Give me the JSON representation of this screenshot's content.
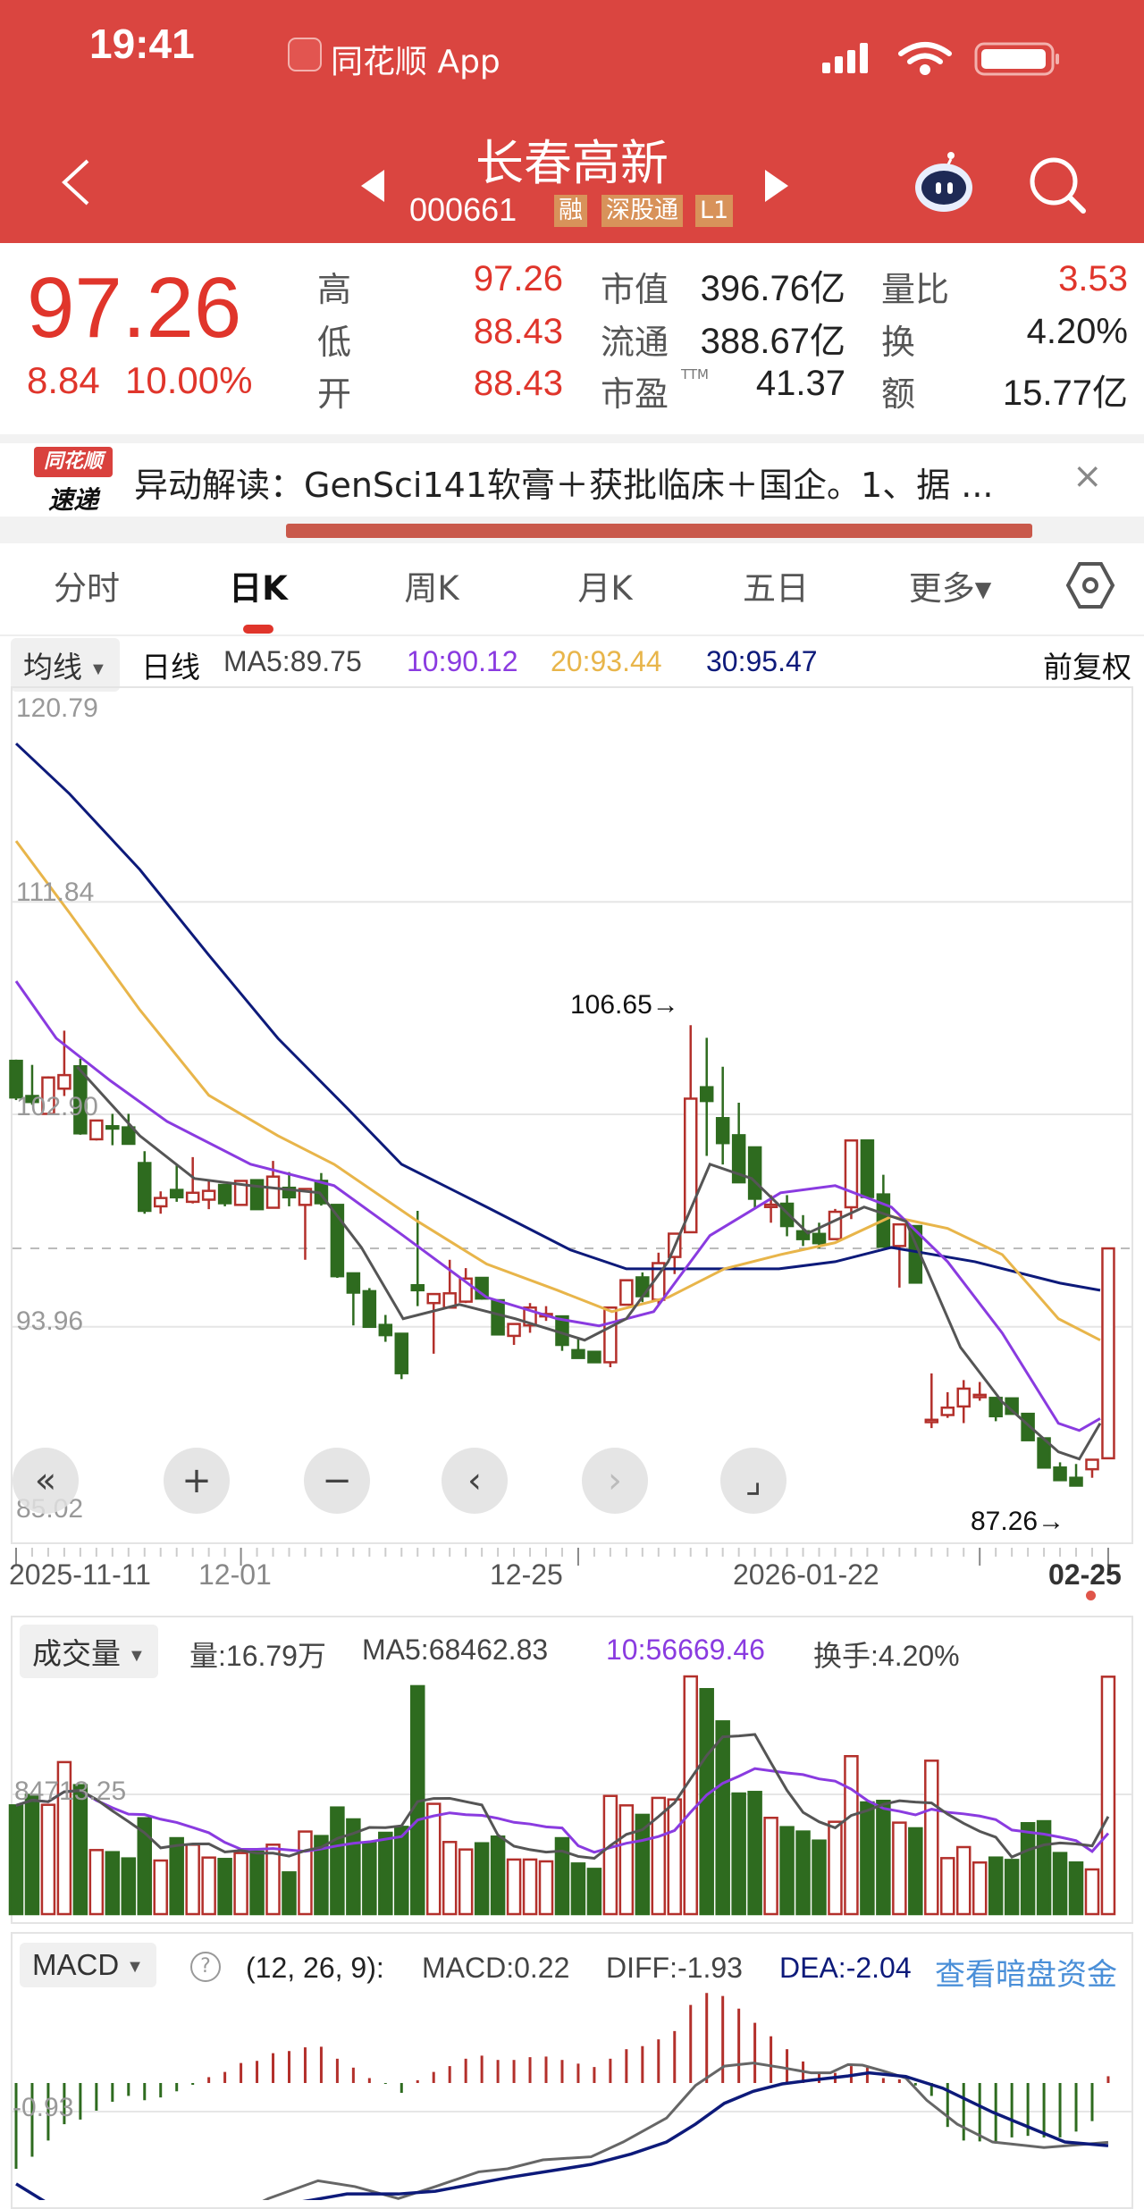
{
  "status_bar": {
    "time": "19:41",
    "app_name": "同花顺 App"
  },
  "stock": {
    "name": "长春高新",
    "code": "000661",
    "badges": [
      "融",
      "深股通",
      "L1"
    ]
  },
  "quote": {
    "price": "97.26",
    "change": "8.84",
    "change_pct": "10.00%",
    "rows": [
      {
        "l1": "高",
        "v1": "97.26",
        "l2": "市值",
        "v2": "396.76亿",
        "l3": "量比",
        "v3": "3.53"
      },
      {
        "l1": "低",
        "v1": "88.43",
        "l2": "流通",
        "v2": "388.67亿",
        "l3": "换",
        "v3": "4.20%"
      },
      {
        "l1": "开",
        "v1": "88.43",
        "l2": "市盈",
        "l2_sup": "TTM",
        "v2": "41.37",
        "l3": "额",
        "v3": "15.77亿"
      }
    ]
  },
  "news": {
    "logo_top": "同花顺",
    "logo_bottom": "速递",
    "text": "异动解读：GenSci141软膏＋获批临床＋国企。1、据 ...",
    "close": "×"
  },
  "tabs": [
    {
      "label": "分时",
      "active": false
    },
    {
      "label": "日K",
      "active": true
    },
    {
      "label": "周K",
      "active": false
    },
    {
      "label": "月K",
      "active": false
    },
    {
      "label": "五日",
      "active": false
    },
    {
      "label": "更多▾",
      "active": false
    }
  ],
  "ma_legend": {
    "selector": "均线",
    "period": "日线",
    "ma5": "MA5:89.75",
    "ma10": "10:90.12",
    "ma20": "20:93.44",
    "ma30": "30:95.47",
    "adjust": "前复权"
  },
  "colors": {
    "up": "#B3302B",
    "down": "#2E6B1F",
    "ma5": "#555555",
    "ma10": "#8A3BE0",
    "ma20": "#E8B54A",
    "ma30": "#0D1A7A",
    "header": "#DA4540",
    "link": "#4A8FD8"
  },
  "controls": [
    "«",
    "+",
    "−",
    "‹",
    "›",
    "⌟"
  ],
  "chart_data": {
    "type": "candlestick",
    "price_axis": {
      "ticks": [
        "120.79",
        "111.84",
        "102.90",
        "93.96",
        "85.02"
      ],
      "ylim": [
        85.02,
        120.79
      ]
    },
    "date_labels": [
      "2025-11-11",
      "12-01",
      "12-25",
      "2026-01-22",
      "02-25"
    ],
    "annotations": {
      "high": "106.65→",
      "low": "87.26→"
    },
    "last_close_ref": 97.26,
    "candles": [
      [
        105.15,
        105.2,
        103.5,
        103.61
      ],
      [
        103.67,
        104.98,
        103.3,
        103.42
      ],
      [
        102.92,
        104.5,
        102.9,
        104.45
      ],
      [
        103.98,
        106.42,
        103.67,
        104.55
      ],
      [
        104.92,
        105.24,
        102.04,
        102.1
      ],
      [
        101.85,
        102.64,
        101.8,
        102.64
      ],
      [
        102.4,
        102.92,
        101.6,
        102.3
      ],
      [
        102.35,
        102.92,
        101.66,
        101.66
      ],
      [
        100.85,
        101.35,
        98.72,
        98.84
      ],
      [
        99.03,
        99.66,
        98.72,
        99.38
      ],
      [
        99.72,
        100.79,
        99.22,
        99.41
      ],
      [
        99.22,
        101.1,
        99.15,
        99.6
      ],
      [
        99.31,
        100.1,
        98.91,
        99.68
      ],
      [
        99.93,
        99.93,
        99.03,
        99.16
      ],
      [
        99.09,
        100.1,
        99.09,
        100.1
      ],
      [
        100.13,
        100.13,
        98.91,
        98.91
      ],
      [
        98.97,
        100.94,
        98.97,
        100.28
      ],
      [
        99.81,
        100.47,
        99.03,
        99.41
      ],
      [
        99.09,
        99.76,
        96.78,
        99.76
      ],
      [
        100.1,
        100.43,
        99.06,
        99.16
      ],
      [
        99.09,
        99.09,
        96.02,
        96.09
      ],
      [
        96.21,
        96.21,
        94.02,
        95.4
      ],
      [
        95.46,
        95.59,
        93.96,
        93.96
      ],
      [
        94.04,
        94.46,
        93.33,
        93.61
      ],
      [
        93.67,
        93.67,
        91.76,
        92.01
      ],
      [
        95.71,
        98.84,
        94.83,
        95.5
      ],
      [
        94.96,
        95.34,
        92.83,
        95.34
      ],
      [
        94.77,
        96.78,
        94.77,
        95.37
      ],
      [
        95.02,
        96.43,
        94.96,
        95.99
      ],
      [
        96.02,
        96.02,
        95.1,
        95.15
      ],
      [
        95.08,
        95.08,
        93.64,
        93.64
      ],
      [
        93.58,
        94.08,
        93.2,
        94.08
      ],
      [
        94.02,
        94.96,
        93.71,
        94.77
      ],
      [
        94.4,
        94.83,
        94.21,
        94.5
      ],
      [
        94.4,
        94.4,
        92.95,
        93.2
      ],
      [
        92.98,
        93.5,
        92.65,
        92.65
      ],
      [
        92.91,
        92.91,
        92.47,
        92.47
      ],
      [
        92.47,
        94.77,
        92.26,
        94.77
      ],
      [
        94.89,
        95.92,
        94.89,
        95.92
      ],
      [
        96.04,
        96.25,
        95.0,
        95.25
      ],
      [
        95.1,
        97.08,
        94.89,
        96.64
      ],
      [
        96.9,
        97.88,
        96.18,
        97.88
      ],
      [
        97.94,
        106.65,
        97.94,
        103.56
      ],
      [
        104.04,
        106.12,
        101.15,
        103.46
      ],
      [
        102.74,
        104.9,
        100.79,
        101.69
      ],
      [
        102.02,
        103.39,
        100.04,
        100.04
      ],
      [
        101.51,
        101.51,
        98.92,
        99.35
      ],
      [
        99.0,
        99.5,
        98.34,
        99.1
      ],
      [
        99.14,
        99.5,
        97.77,
        98.2
      ],
      [
        97.98,
        98.66,
        97.36,
        97.65
      ],
      [
        97.87,
        98.34,
        97.26,
        97.48
      ],
      [
        97.65,
        98.92,
        97.65,
        98.8
      ],
      [
        98.99,
        101.8,
        98.49,
        101.8
      ],
      [
        101.8,
        101.8,
        99.42,
        99.42
      ],
      [
        99.53,
        100.36,
        97.33,
        97.33
      ],
      [
        97.36,
        98.27,
        95.61,
        98.27
      ],
      [
        98.2,
        98.2,
        95.82,
        95.82
      ],
      [
        89.95,
        92.0,
        89.7,
        90.05
      ],
      [
        90.25,
        91.21,
        90.13,
        90.56
      ],
      [
        90.61,
        91.72,
        89.91,
        91.36
      ],
      [
        91.0,
        91.64,
        90.85,
        91.1
      ],
      [
        90.97,
        90.97,
        89.99,
        90.2
      ],
      [
        90.95,
        90.95,
        90.3,
        90.3
      ],
      [
        90.3,
        90.3,
        89.19,
        89.19
      ],
      [
        89.27,
        89.27,
        88.04,
        88.04
      ],
      [
        88.04,
        88.26,
        87.47,
        87.51
      ],
      [
        87.61,
        88.19,
        87.26,
        87.28
      ],
      [
        87.97,
        88.37,
        87.61,
        88.37
      ],
      [
        88.43,
        97.26,
        88.43,
        97.26
      ]
    ],
    "ma_lines": {
      "ma5": [
        [
          3.8,
          104.9
        ],
        [
          7.7,
          102.0
        ],
        [
          11.1,
          100.2
        ],
        [
          14.6,
          99.9
        ],
        [
          18.9,
          99.6
        ],
        [
          21.5,
          97.3
        ],
        [
          24.1,
          94.3
        ],
        [
          27.6,
          94.9
        ],
        [
          31.1,
          94.3
        ],
        [
          35.4,
          93.4
        ],
        [
          38,
          94.3
        ],
        [
          40.6,
          96.7
        ],
        [
          43.2,
          100.8
        ],
        [
          45.8,
          100.2
        ],
        [
          49.3,
          97.9
        ],
        [
          52.8,
          99.0
        ],
        [
          55.4,
          98.4
        ],
        [
          58.8,
          93.1
        ],
        [
          61.4,
          90.8
        ],
        [
          64.9,
          88.7
        ],
        [
          66.2,
          88.4
        ],
        [
          67.5,
          89.9
        ]
      ],
      "ma10": [
        [
          0,
          108.5
        ],
        [
          2.5,
          106.1
        ],
        [
          5.9,
          104.3
        ],
        [
          9.4,
          102.6
        ],
        [
          14.6,
          100.8
        ],
        [
          19.8,
          99.9
        ],
        [
          24.1,
          97.8
        ],
        [
          29.3,
          95.2
        ],
        [
          33.7,
          94.3
        ],
        [
          36.3,
          94.0
        ],
        [
          39.7,
          94.6
        ],
        [
          43.2,
          97.8
        ],
        [
          47.6,
          99.6
        ],
        [
          51,
          99.9
        ],
        [
          54.5,
          99.0
        ],
        [
          58,
          96.7
        ],
        [
          61.4,
          93.7
        ],
        [
          64.9,
          89.9
        ],
        [
          66.2,
          89.6
        ],
        [
          67.5,
          90.1
        ]
      ],
      "ma20": [
        [
          0,
          114.4
        ],
        [
          3.3,
          111.4
        ],
        [
          7.7,
          107.3
        ],
        [
          12,
          103.7
        ],
        [
          16.3,
          102.0
        ],
        [
          19.8,
          100.8
        ],
        [
          25,
          98.4
        ],
        [
          29.3,
          96.6
        ],
        [
          33.7,
          95.5
        ],
        [
          37.1,
          94.6
        ],
        [
          40.6,
          95.2
        ],
        [
          44.1,
          96.4
        ],
        [
          47.6,
          97.0
        ],
        [
          51,
          97.5
        ],
        [
          54.5,
          98.6
        ],
        [
          58,
          98.1
        ],
        [
          61.4,
          97.0
        ],
        [
          64.9,
          94.3
        ],
        [
          67.5,
          93.4
        ]
      ],
      "ma30": [
        [
          0,
          118.5
        ],
        [
          3.3,
          116.4
        ],
        [
          7.7,
          113.2
        ],
        [
          12,
          109.6
        ],
        [
          16.3,
          106.1
        ],
        [
          20.7,
          103.1
        ],
        [
          24,
          100.8
        ],
        [
          29.3,
          99.0
        ],
        [
          34.5,
          97.2
        ],
        [
          38,
          96.4
        ],
        [
          42.3,
          96.4
        ],
        [
          47.5,
          96.4
        ],
        [
          51,
          96.7
        ],
        [
          54.5,
          97.3
        ],
        [
          59.7,
          96.7
        ],
        [
          65,
          95.8
        ],
        [
          67.5,
          95.5
        ]
      ]
    },
    "volume": {
      "header": {
        "selector": "成交量",
        "vol": "量:16.79万",
        "ma5": "MA5:68462.83",
        "ma10": "10:56669.46",
        "turnover": "换手:4.20%"
      },
      "axis_tick": "84713.25",
      "values": [
        76900,
        84300,
        77300,
        107500,
        91200,
        45300,
        43800,
        39400,
        67800,
        37900,
        53700,
        49100,
        40000,
        39000,
        43200,
        44200,
        49100,
        29500,
        58400,
        55200,
        75400,
        67000,
        50600,
        57500,
        61700,
        161200,
        78000,
        51000,
        45700,
        50100,
        54800,
        38600,
        38600,
        37300,
        53700,
        35800,
        32000,
        83600,
        76900,
        70200,
        82200,
        81100,
        168100,
        159100,
        136300,
        85300,
        86400,
        68100,
        61500,
        58400,
        52000,
        65300,
        111700,
        79000,
        80100,
        64700,
        60700,
        108500,
        39600,
        47400,
        36500,
        40000,
        38300,
        64300,
        65700,
        43200,
        36500,
        31600,
        167900
      ]
    },
    "macd": {
      "header": {
        "selector": "MACD",
        "help": "?",
        "params": "(12, 26, 9):",
        "macd": "MACD:0.22",
        "diff": "DIFF:-1.93",
        "dea": "DEA:-2.04",
        "link": "查看暗盘资金"
      },
      "axis_tick": "-0.93",
      "hist": [
        -2.79,
        -2.4,
        -1.87,
        -1.34,
        -1.19,
        -0.9,
        -0.61,
        -0.42,
        -0.56,
        -0.47,
        -0.27,
        -0.06,
        0.19,
        0.36,
        0.65,
        0.72,
        0.97,
        1.04,
        1.16,
        1.18,
        0.79,
        0.5,
        0.16,
        -0.03,
        -0.32,
        0.09,
        0.36,
        0.55,
        0.79,
        0.89,
        0.75,
        0.75,
        0.84,
        0.86,
        0.75,
        0.63,
        0.52,
        0.79,
        1.1,
        1.2,
        1.42,
        1.69,
        2.54,
        2.93,
        2.83,
        2.42,
        1.96,
        1.52,
        1.1,
        0.7,
        0.36,
        0.33,
        0.55,
        0.5,
        0.16,
        0.12,
        -0.08,
        -0.42,
        -1.43,
        -1.87,
        -1.9,
        -1.97,
        -1.77,
        -1.72,
        -1.77,
        -1.77,
        -1.58,
        -1.24,
        0.22
      ],
      "diff": [
        [
          0,
          -5.6
        ],
        [
          8,
          -5.0
        ],
        [
          14,
          -4.2
        ],
        [
          15.7,
          -3.76
        ],
        [
          18.8,
          -3.18
        ],
        [
          21.1,
          -3.37
        ],
        [
          23.8,
          -3.76
        ],
        [
          26.1,
          -3.37
        ],
        [
          28.8,
          -2.89
        ],
        [
          30.6,
          -2.79
        ],
        [
          32.8,
          -2.5
        ],
        [
          35.8,
          -2.4
        ],
        [
          37.8,
          -1.92
        ],
        [
          40.5,
          -1.14
        ],
        [
          42.3,
          -0.08
        ],
        [
          44.1,
          0.55
        ],
        [
          45.9,
          0.65
        ],
        [
          47.7,
          0.5
        ],
        [
          49.5,
          0.33
        ],
        [
          50.7,
          0.33
        ],
        [
          51.8,
          0.6
        ],
        [
          52.7,
          0.58
        ],
        [
          54,
          0.39
        ],
        [
          55.4,
          0.16
        ],
        [
          56.7,
          -0.56
        ],
        [
          58.6,
          -1.34
        ],
        [
          60.8,
          -1.92
        ],
        [
          64,
          -2.1
        ],
        [
          68,
          -1.93
        ]
      ],
      "dea": [
        [
          0,
          -3.28
        ],
        [
          1.8,
          -3.86
        ],
        [
          8,
          -4.4
        ],
        [
          15,
          -4.1
        ],
        [
          18.4,
          -3.81
        ],
        [
          20.6,
          -3.61
        ],
        [
          23.8,
          -3.61
        ],
        [
          26.1,
          -3.52
        ],
        [
          30.6,
          -3.08
        ],
        [
          35.8,
          -2.65
        ],
        [
          38.3,
          -2.31
        ],
        [
          40.5,
          -1.92
        ],
        [
          42.3,
          -1.34
        ],
        [
          44.1,
          -0.66
        ],
        [
          45.9,
          -0.27
        ],
        [
          47.7,
          -0.03
        ],
        [
          49.5,
          0.09
        ],
        [
          51.8,
          0.23
        ],
        [
          53.1,
          0.33
        ],
        [
          55.4,
          0.21
        ],
        [
          57.7,
          -0.17
        ],
        [
          60.8,
          -0.95
        ],
        [
          65.3,
          -1.92
        ],
        [
          68,
          -2.04
        ]
      ]
    }
  }
}
